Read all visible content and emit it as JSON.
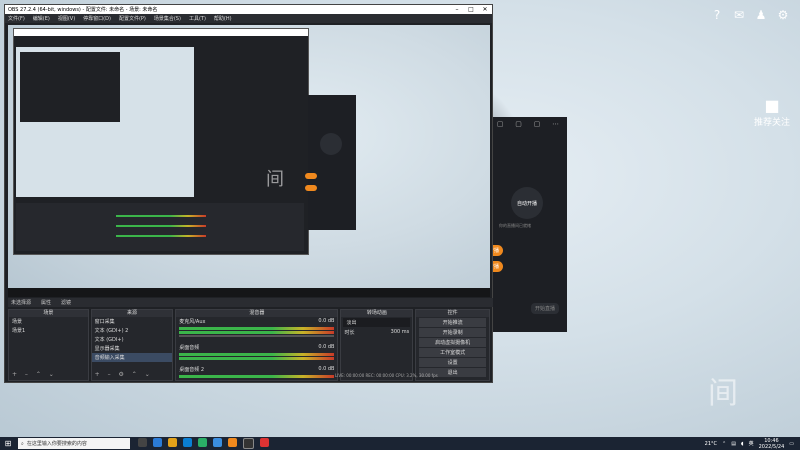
{
  "desktop": {
    "watermark": "间",
    "follow_label": "推荐关注",
    "top_icons": [
      "help-icon",
      "mail-icon",
      "user-icon",
      "settings-icon"
    ]
  },
  "right_panel": {
    "circle_label": "自动开播",
    "sub_label": "你的直播间已就绪",
    "btn1": "开播",
    "btn2": "开播",
    "footer": "开始直播"
  },
  "obs": {
    "title": "OBS 27.2.4 (64-bit, windows) - 配置文件: 未命名 - 场景: 未命名",
    "menu": [
      "文件(F)",
      "编辑(E)",
      "视图(V)",
      "停靠窗口(D)",
      "配置文件(P)",
      "场景集合(S)",
      "工具(T)",
      "帮助(H)"
    ],
    "toolbar": [
      "未选择源",
      "属性",
      "滤镜"
    ],
    "scenes": {
      "header": "场景",
      "items": [
        "场景",
        "场景1"
      ]
    },
    "sources": {
      "header": "来源",
      "items": [
        "窗口采集",
        "文本 (GDI+) 2",
        "文本 (GDI+)",
        "显示器采集",
        "音频输入采集"
      ]
    },
    "mixer": {
      "header": "混音器",
      "channels": [
        {
          "name": "麦克风/Aux",
          "db": "0.0 dB"
        },
        {
          "name": "桌面音频",
          "db": "0.0 dB"
        },
        {
          "name": "桌面音频 2",
          "db": "0.0 dB"
        }
      ]
    },
    "transitions": {
      "header": "转场动画",
      "type": "淡出",
      "duration_label": "时长",
      "duration": "300 ms"
    },
    "controls": {
      "header": "控件",
      "buttons": [
        "开始推流",
        "开始录制",
        "启动虚拟摄像机",
        "工作室模式",
        "设置",
        "退出"
      ]
    },
    "status": "LIVE: 00:00:00  REC: 00:00:00  CPU: 3.2%, 30.00 fps"
  },
  "taskbar": {
    "search_placeholder": "在这里输入你要搜索的内容",
    "weather": "21°C",
    "lang": "英",
    "time": "10:46",
    "date": "2022/5/24"
  }
}
